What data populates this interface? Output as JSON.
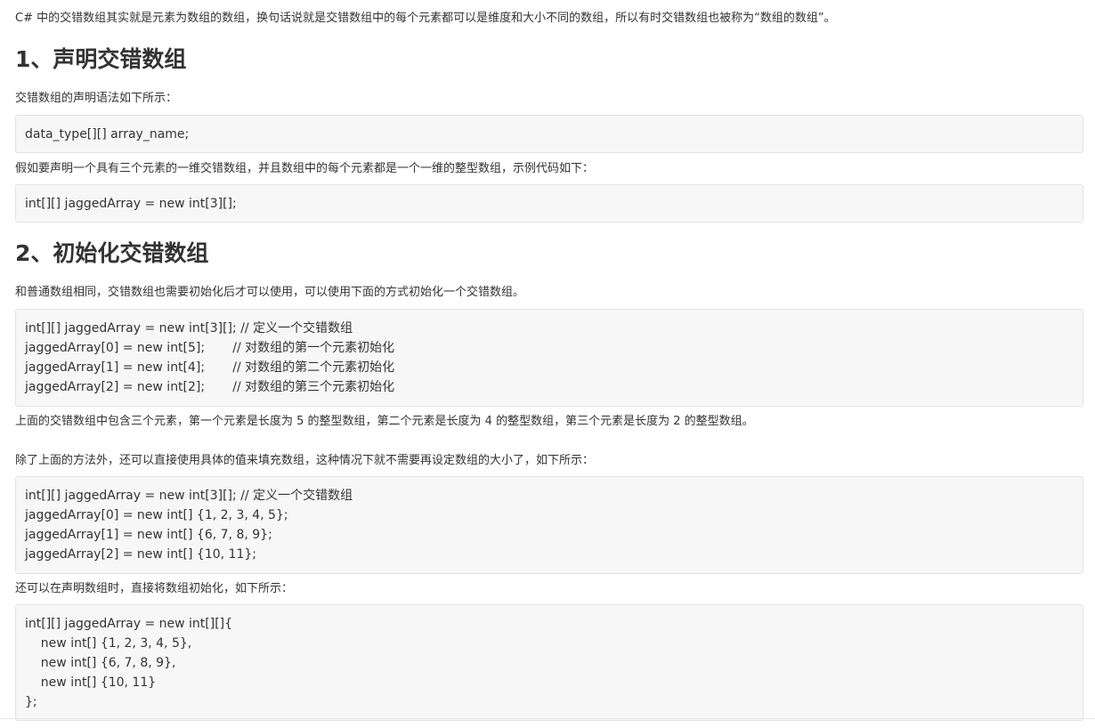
{
  "intro": "C# 中的交错数组其实就是元素为数组的数组，换句话说就是交错数组中的每个元素都可以是维度和大小不同的数组，所以有时交错数组也被称为“数组的数组”。",
  "section1": {
    "heading": "1、声明交错数组",
    "text1": "交错数组的声明语法如下所示：",
    "code1": [
      "data_type[][] array_name;"
    ],
    "text2": "假如要声明一个具有三个元素的一维交错数组，并且数组中的每个元素都是一个一维的整型数组，示例代码如下：",
    "code2": [
      "int[][] jaggedArray = new int[3][];"
    ]
  },
  "section2": {
    "heading": "2、初始化交错数组",
    "text1": "和普通数组相同，交错数组也需要初始化后才可以使用，可以使用下面的方式初始化一个交错数组。",
    "code1": [
      "int[][] jaggedArray = new int[3][]; // 定义一个交错数组",
      "jaggedArray[0] = new int[5];       // 对数组的第一个元素初始化",
      "jaggedArray[1] = new int[4];       // 对数组的第二个元素初始化",
      "jaggedArray[2] = new int[2];       // 对数组的第三个元素初始化"
    ],
    "text2": "上面的交错数组中包含三个元素，第一个元素是长度为 5 的整型数组，第二个元素是长度为 4 的整型数组，第三个元素是长度为 2 的整型数组。",
    "text3": "除了上面的方法外，还可以直接使用具体的值来填充数组，这种情况下就不需要再设定数组的大小了，如下所示：",
    "code2": [
      "int[][] jaggedArray = new int[3][]; // 定义一个交错数组",
      "jaggedArray[0] = new int[] {1, 2, 3, 4, 5};",
      "jaggedArray[1] = new int[] {6, 7, 8, 9};",
      "jaggedArray[2] = new int[] {10, 11};"
    ],
    "text4": "还可以在声明数组时，直接将数组初始化，如下所示：",
    "code3": [
      "int[][] jaggedArray = new int[][]{",
      "    new int[] {1, 2, 3, 4, 5},",
      "    new int[] {6, 7, 8, 9},",
      "    new int[] {10, 11}",
      "};"
    ]
  }
}
